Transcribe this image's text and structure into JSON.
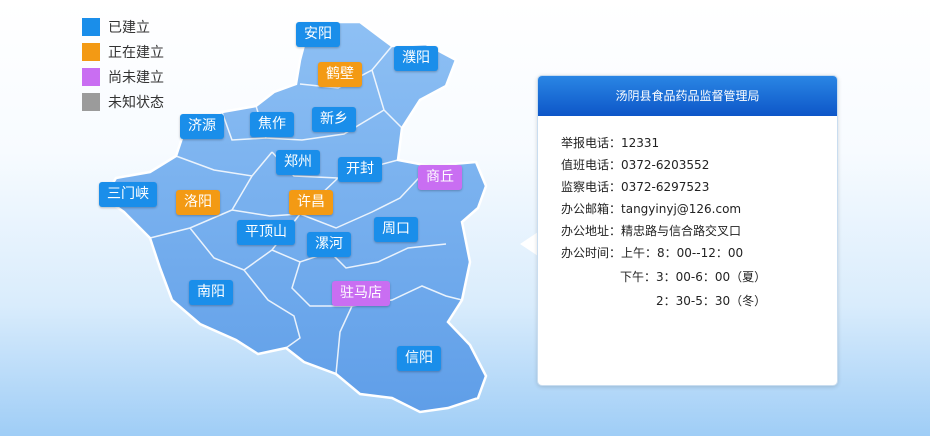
{
  "legend": [
    {
      "label": "已建立",
      "color": "#1a8eea"
    },
    {
      "label": "正在建立",
      "color": "#f39a14"
    },
    {
      "label": "尚未建立",
      "color": "#c96ef2"
    },
    {
      "label": "未知状态",
      "color": "#9b9b9b"
    }
  ],
  "colors": {
    "map_fill": "#6aa8ee",
    "map_fill_light": "#9cc8f6",
    "map_border": "#ffffff",
    "header": "#1565d8"
  },
  "cities": {
    "anyang": {
      "name": "安阳",
      "status": "已建立"
    },
    "puyang": {
      "name": "濮阳",
      "status": "已建立"
    },
    "hebi": {
      "name": "鹤壁",
      "status": "正在建立"
    },
    "jiaozuo": {
      "name": "焦作",
      "status": "已建立"
    },
    "jiyuan": {
      "name": "济源",
      "status": "已建立"
    },
    "xinxiang": {
      "name": "新乡",
      "status": "已建立"
    },
    "zhengzhou": {
      "name": "郑州",
      "status": "已建立"
    },
    "kaifeng": {
      "name": "开封",
      "status": "已建立"
    },
    "shangqiu": {
      "name": "商丘",
      "status": "尚未建立"
    },
    "sanmenxia": {
      "name": "三门峡",
      "status": "已建立"
    },
    "luoyang": {
      "name": "洛阳",
      "status": "正在建立"
    },
    "xuchang": {
      "name": "许昌",
      "status": "正在建立"
    },
    "pingdingshan": {
      "name": "平顶山",
      "status": "已建立"
    },
    "zhoukou": {
      "name": "周口",
      "status": "已建立"
    },
    "luohe": {
      "name": "漯河",
      "status": "已建立"
    },
    "nanyang": {
      "name": "南阳",
      "status": "已建立"
    },
    "zhumadian": {
      "name": "驻马店",
      "status": "尚未建立"
    },
    "xinyang": {
      "name": "信阳",
      "status": "已建立"
    }
  },
  "panel": {
    "title": "汤阴县食品药品监督管理局",
    "report_phone_label": "举报电话：",
    "report_phone": "12331",
    "duty_phone_label": "值班电话：",
    "duty_phone": "0372-6203552",
    "supervise_phone_label": "监察电话：",
    "supervise_phone": "0372-6297523",
    "email_label": "办公邮箱：",
    "email": "tangyinyj@126.com",
    "address_label": "办公地址：",
    "address": "精忠路与信合路交叉口",
    "hours_label": "办公时间：",
    "hours_am": "上午：8：00--12：00",
    "hours_pm": "下午：3：00-6：00（夏）",
    "hours_pm_winter": "2：30-5：30（冬）"
  }
}
